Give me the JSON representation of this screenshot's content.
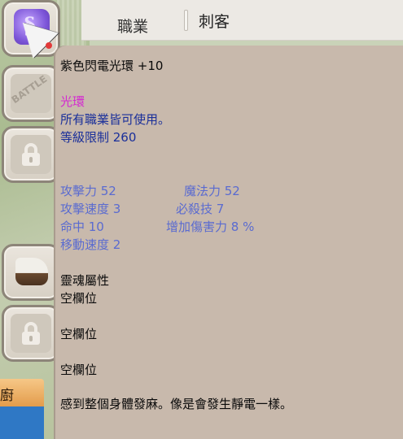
{
  "header": {
    "label": "職業",
    "value": "刺客"
  },
  "left_panel": {
    "battle_badge": "BATTLE",
    "side_tab_label": "廚"
  },
  "tooltip": {
    "item_name": "紫色閃電光環 +10",
    "category": "光環",
    "usable": "所有職業皆可使用。",
    "level_req": "等級限制 260",
    "stats": {
      "attack": "攻擊力 52",
      "magic": "魔法力 52",
      "attack_speed": "攻擊速度 3",
      "crit": "必殺技 7",
      "hit": "命中 10",
      "dmg_bonus": "增加傷害力 8 %",
      "move_speed": "移動速度 2"
    },
    "soul_attr_label": "靈魂屬性",
    "slots": [
      "空欄位",
      "空欄位",
      "空欄位"
    ],
    "description": "感到整個身體發麻。像是會發生靜電一樣。"
  },
  "colors": {
    "tooltip_bg": "#c8b9ac",
    "category_color": "#d42ad0",
    "info_color": "#1a2f9a",
    "stat_color": "#5a6bd0"
  }
}
